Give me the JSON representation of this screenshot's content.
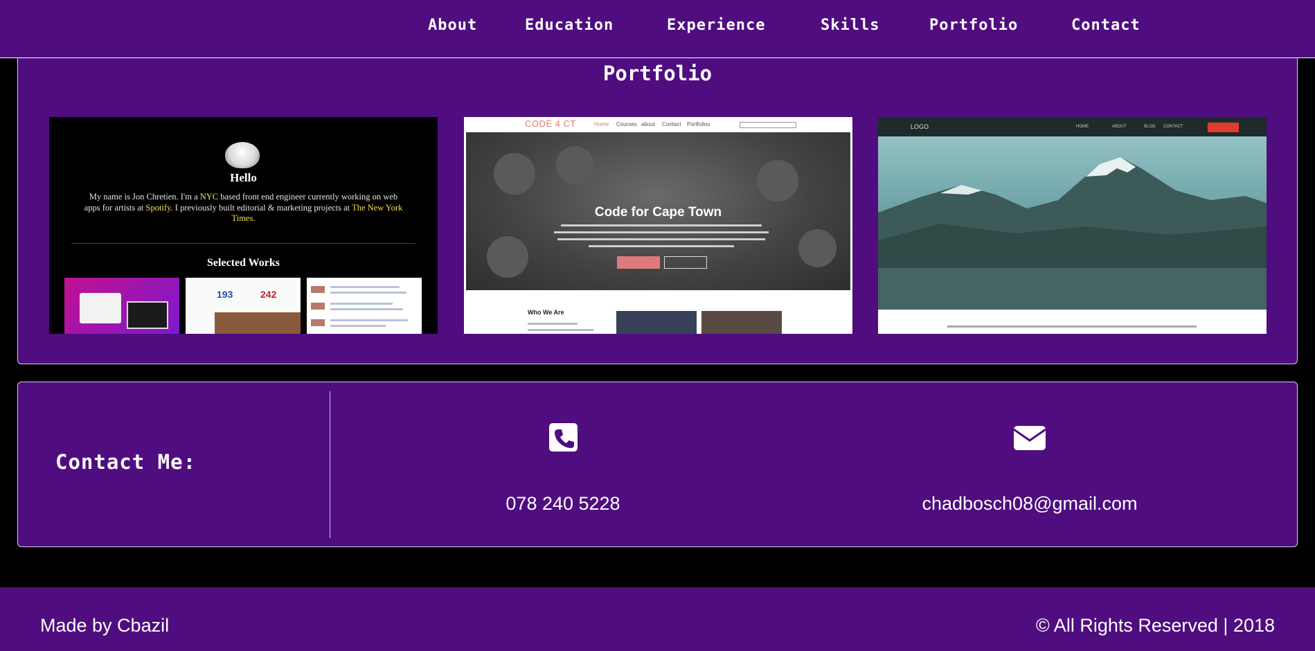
{
  "nav": {
    "items": [
      {
        "label": "About"
      },
      {
        "label": "Education"
      },
      {
        "label": "Experience"
      },
      {
        "label": "Skills"
      },
      {
        "label": "Portfolio"
      },
      {
        "label": "Contact"
      }
    ]
  },
  "portfolio": {
    "title": "Portfolio",
    "card1": {
      "hello": "Hello",
      "bio_a": "My name is Jon Chretien. I'm a ",
      "bio_nyc": "NYC",
      "bio_b": " based front end engineer currently working on web apps for artists at ",
      "bio_spotify": "Spotify",
      "bio_c": ". I previously built editorial & marketing projects at ",
      "bio_nyt": "The New York Times",
      "bio_d": ".",
      "works": "Selected Works",
      "stat1": "193",
      "stat2": "242"
    },
    "card2": {
      "logo": "CODE 4 CT",
      "menu": [
        "Home",
        "Courses",
        "about",
        "Contact",
        "Portfolios"
      ],
      "hero_title": "Code for Cape Town",
      "who": "Who We Are"
    },
    "card3": {
      "logo": "LOGO",
      "menu": [
        "HOME",
        "ABOUT",
        "BLOG",
        "CONTACT"
      ]
    }
  },
  "contact": {
    "title": "Contact Me:",
    "phone": "078 240 5228",
    "email": "chadbosch08@gmail.com",
    "phone_icon": "phone-square-icon",
    "email_icon": "envelope-icon"
  },
  "footer": {
    "left": "Made by Cbazil",
    "right": "© All Rights Reserved | 2018"
  },
  "colors": {
    "brand_purple": "#4f0d80",
    "background": "#000000",
    "text": "#ffffff"
  }
}
